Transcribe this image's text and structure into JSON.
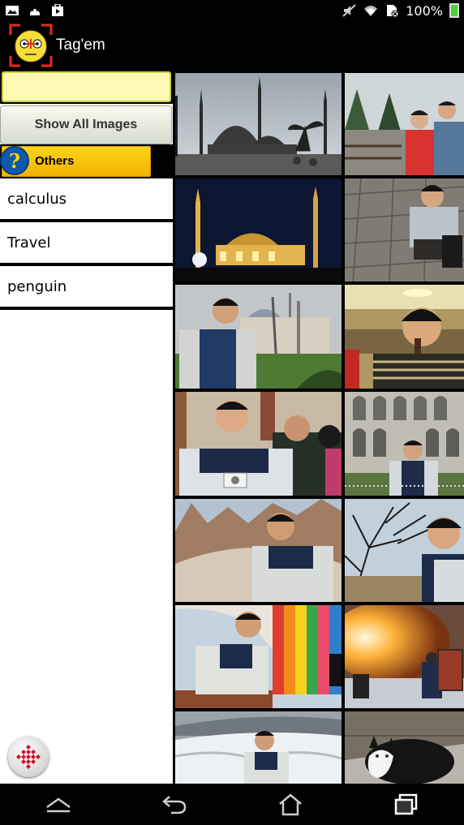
{
  "status_bar": {
    "battery_percent": "100%",
    "left_icons": [
      "gallery-icon",
      "android-debug-icon",
      "play-store-icon"
    ],
    "right_icons": [
      "mute-icon",
      "wifi-icon",
      "sim-icon"
    ]
  },
  "app_bar": {
    "title": "Tag'em",
    "logo_icon": "tagem-face-icon"
  },
  "sidebar": {
    "search": {
      "value": "",
      "placeholder": ""
    },
    "show_all_label": "Show All Images",
    "others_label": "Others",
    "tags": [
      {
        "label": "calculus"
      },
      {
        "label": "Travel"
      },
      {
        "label": "penguin"
      }
    ]
  },
  "images": [
    {
      "subject": "mosque-day"
    },
    {
      "subject": "couple-park"
    },
    {
      "subject": "mosque-night"
    },
    {
      "subject": "man-crouching-cobblestone"
    },
    {
      "subject": "man-mosque-garden"
    },
    {
      "subject": "man-eating-restaurant"
    },
    {
      "subject": "man-camera"
    },
    {
      "subject": "man-arcade-building"
    },
    {
      "subject": "man-cappadocia"
    },
    {
      "subject": "man-bare-tree"
    },
    {
      "subject": "man-hot-air-balloon"
    },
    {
      "subject": "balloon-burner"
    },
    {
      "subject": "man-snowy-terraces"
    },
    {
      "subject": "cat"
    }
  ],
  "colors": {
    "search_bg": "#fbf9b3",
    "others_tab": "#ffd21a",
    "help_circle": "#0d5aa8",
    "battery": "#4cd23a"
  },
  "nav_bar": {
    "buttons": [
      "back-dismiss-icon",
      "back-icon",
      "home-icon",
      "recent-apps-icon"
    ]
  }
}
